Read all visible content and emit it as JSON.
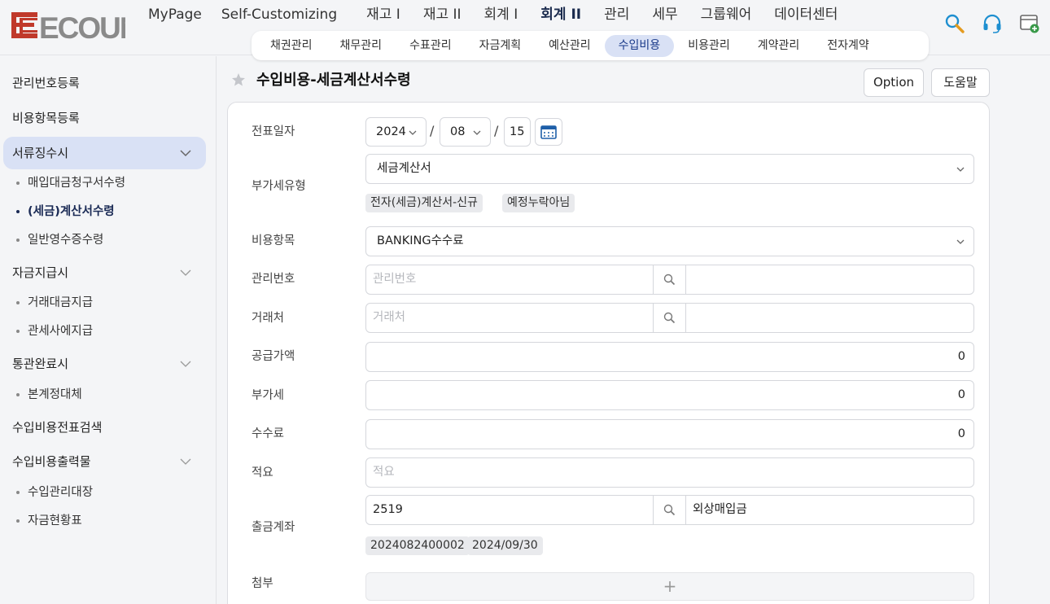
{
  "header": {
    "logo_text": "ECOUNT",
    "main_nav": [
      "MyPage",
      "Self-Customizing",
      "재고 I",
      "재고 II",
      "회계 I",
      "회계 II",
      "관리",
      "세무",
      "그룹웨어",
      "데이터센터"
    ],
    "main_nav_active": "회계 II",
    "sub_nav": [
      "채권관리",
      "채무관리",
      "수표관리",
      "자금계획",
      "예산관리",
      "수입비용",
      "비용관리",
      "계약관리",
      "전자계약"
    ],
    "sub_nav_active": "수입비용",
    "icons": [
      "search-icon",
      "headset-icon",
      "browser-add-icon"
    ]
  },
  "sidebar": {
    "items": [
      {
        "label": "관리번호등록"
      },
      {
        "label": "비용항목등록"
      },
      {
        "label": "서류징수시"
      },
      {
        "label": "매입대금청구서수령"
      },
      {
        "label": "(세금)계산서수령"
      },
      {
        "label": "일반영수증수령"
      },
      {
        "label": "자금지급시"
      },
      {
        "label": "거래대금지급"
      },
      {
        "label": "관세사에지급"
      },
      {
        "label": "통관완료시"
      },
      {
        "label": "본계정대체"
      },
      {
        "label": "수입비용전표검색"
      },
      {
        "label": "수입비용출력물"
      },
      {
        "label": "수입관리대장"
      },
      {
        "label": "자금현황표"
      }
    ]
  },
  "page": {
    "title": "수입비용-세금계산서수령",
    "option_button": "Option",
    "help_button": "도움말"
  },
  "form": {
    "date_label": "전표일자",
    "date_year": "2024",
    "date_month": "08",
    "date_day": "15",
    "date_sep": "/",
    "vat_type_label": "부가세유형",
    "vat_type_value": "세금계산서",
    "vat_tag1": "전자(세금)계산서-신규",
    "vat_tag2": "예정누락아님",
    "expense_item_label": "비용항목",
    "expense_item_value": "BANKING수수료",
    "mgmt_no_label": "관리번호",
    "mgmt_no_placeholder": "관리번호",
    "vendor_label": "거래처",
    "vendor_placeholder": "거래처",
    "supply_amount_label": "공급가액",
    "supply_amount_value": "0",
    "vat_label": "부가세",
    "vat_value": "0",
    "fee_label": "수수료",
    "fee_value": "0",
    "memo_label": "적요",
    "memo_placeholder": "적요",
    "account_label": "출금계좌",
    "account_code": "2519",
    "account_name": "외상매입금",
    "account_tag1": "2024082400002",
    "account_tag2": "2024/09/30",
    "attach_label": "첨부",
    "attach_plus": "+"
  }
}
